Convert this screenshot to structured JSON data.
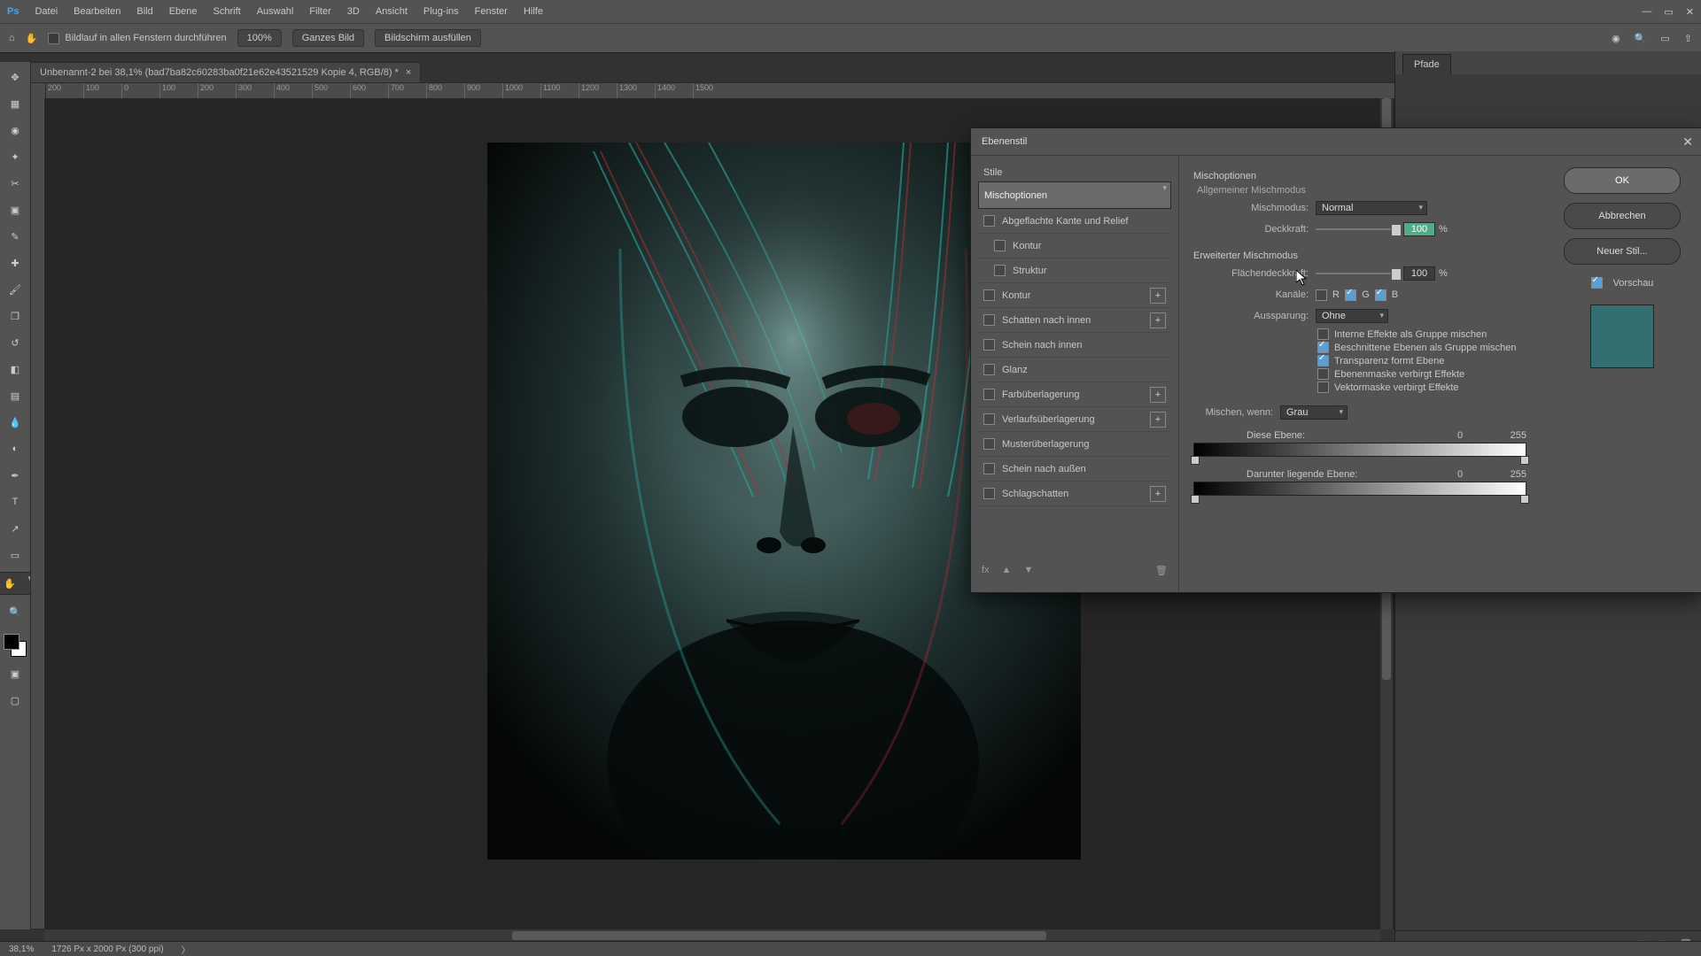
{
  "menu": {
    "items": [
      "Datei",
      "Bearbeiten",
      "Bild",
      "Ebene",
      "Schrift",
      "Auswahl",
      "Filter",
      "3D",
      "Ansicht",
      "Plug-ins",
      "Fenster",
      "Hilfe"
    ]
  },
  "optbar": {
    "scroll_all": "Bildlauf in allen Fenstern durchführen",
    "zoom": "100%",
    "fit": "Ganzes Bild",
    "fill": "Bildschirm ausfüllen"
  },
  "doc": {
    "title": "Unbenannt-2 bei 38,1% (bad7ba82c60283ba0f21e62e43521529 Kopie 4, RGB/8) *"
  },
  "ruler": {
    "marks": [
      "200",
      "100",
      "0",
      "100",
      "200",
      "300",
      "400",
      "500",
      "600",
      "700",
      "800",
      "900",
      "1000",
      "1100",
      "1200",
      "1300",
      "1400",
      "1500"
    ]
  },
  "status": {
    "zoom": "38,1%",
    "dim": "1726 Px x 2000 Px (300 ppi)"
  },
  "right_panel": {
    "tab": "Pfade"
  },
  "dialog": {
    "title": "Ebenenstil",
    "styles_header": "Stile",
    "styles": [
      {
        "label": "Mischoptionen",
        "selected": true
      },
      {
        "label": "Abgeflachte Kante und Relief",
        "cb": true
      },
      {
        "label": "Kontur",
        "cb": true,
        "indent": true
      },
      {
        "label": "Struktur",
        "cb": true,
        "indent": true
      },
      {
        "label": "Kontur",
        "cb": true,
        "plus": true
      },
      {
        "label": "Schatten nach innen",
        "cb": true,
        "plus": true
      },
      {
        "label": "Schein nach innen",
        "cb": true
      },
      {
        "label": "Glanz",
        "cb": true
      },
      {
        "label": "Farbüberlagerung",
        "cb": true,
        "plus": true
      },
      {
        "label": "Verlaufsüberlagerung",
        "cb": true,
        "plus": true
      },
      {
        "label": "Musterüberlagerung",
        "cb": true
      },
      {
        "label": "Schein nach außen",
        "cb": true
      },
      {
        "label": "Schlagschatten",
        "cb": true,
        "plus": true
      }
    ],
    "opts": {
      "section1": "Mischoptionen",
      "section1b": "Allgemeiner Mischmodus",
      "mode_label": "Mischmodus:",
      "mode_value": "Normal",
      "opacity_label": "Deckkraft:",
      "opacity_value": "100",
      "pct": "%",
      "section2": "Erweiterter Mischmodus",
      "fill_label": "Flächendeckkraft:",
      "fill_value": "100",
      "channels_label": "Kanäle:",
      "ch_r": "R",
      "ch_g": "G",
      "ch_b": "B",
      "knockout_label": "Aussparung:",
      "knockout_value": "Ohne",
      "adv": [
        {
          "on": false,
          "label": "Interne Effekte als Gruppe mischen"
        },
        {
          "on": true,
          "label": "Beschnittene Ebenen als Gruppe mischen"
        },
        {
          "on": true,
          "label": "Transparenz formt Ebene"
        },
        {
          "on": false,
          "label": "Ebenenmaske verbirgt Effekte"
        },
        {
          "on": false,
          "label": "Vektormaske verbirgt Effekte"
        }
      ],
      "blendif_label": "Mischen, wenn:",
      "blendif_value": "Grau",
      "this_label": "Diese Ebene:",
      "this_lo": "0",
      "this_hi": "255",
      "under_label": "Darunter liegende Ebene:",
      "under_lo": "0",
      "under_hi": "255"
    },
    "buttons": {
      "ok": "OK",
      "cancel": "Abbrechen",
      "new": "Neuer Stil...",
      "preview": "Vorschau"
    }
  }
}
